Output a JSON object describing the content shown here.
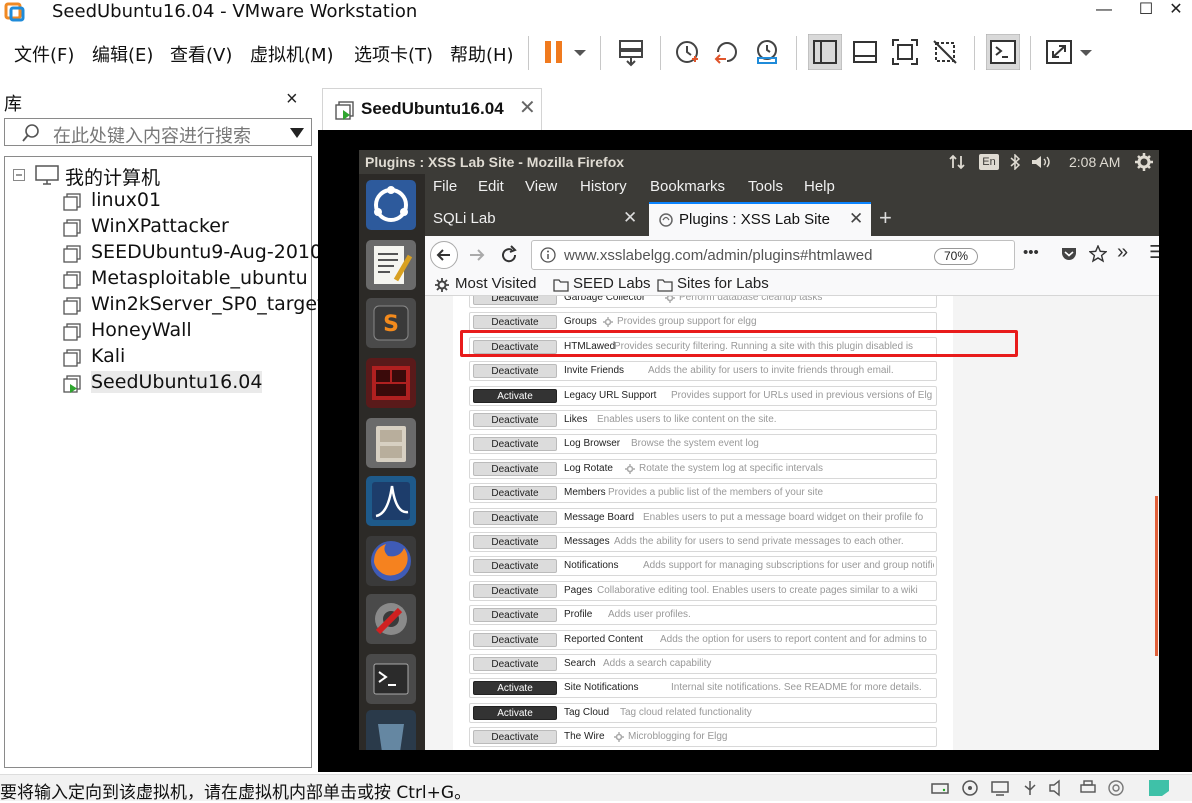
{
  "window": {
    "title": "SeedUbuntu16.04 - VMware Workstation",
    "minimize": "—",
    "maximize": "☐",
    "close": "✕"
  },
  "menu": [
    "文件(F)",
    "编辑(E)",
    "查看(V)",
    "虚拟机(M)",
    "选项卡(T)",
    "帮助(H)"
  ],
  "library": {
    "title": "库",
    "close": "×",
    "search_placeholder": "在此处键入内容进行搜索",
    "root": "我的计算机",
    "vms": [
      "linux01",
      "WinXPattacker",
      "SEEDUbuntu9-Aug-2010",
      "Metasploitable_ubuntu",
      "Win2kServer_SP0_target",
      "HoneyWall",
      "Kali",
      "SeedUbuntu16.04"
    ],
    "selected": "SeedUbuntu16.04"
  },
  "vm_tab": {
    "label": "SeedUbuntu16.04",
    "close": "✕"
  },
  "ubuntu": {
    "window_title": "Plugins : XSS Lab Site - Mozilla Firefox",
    "keyboard": "En",
    "clock": "2:08 AM"
  },
  "firefox": {
    "menus": [
      "File",
      "Edit",
      "View",
      "History",
      "Bookmarks",
      "Tools",
      "Help"
    ],
    "tabs": [
      {
        "label": "SQLi Lab",
        "close": "✕"
      },
      {
        "label": "Plugins : XSS Lab Site",
        "close": "✕"
      }
    ],
    "new_tab": "+",
    "url": "www.xsslabelgg.com/admin/plugins#htmlawed",
    "zoom": "70%",
    "page_actions": "•••",
    "overflow": "»",
    "menu_button": "☰",
    "bookmarks": [
      "Most Visited",
      "SEED Labs",
      "Sites for Labs"
    ]
  },
  "plugins": [
    {
      "action": "Deactivate",
      "name": "Garbage Collector",
      "gear": true,
      "desc": "Perform database cleanup tasks"
    },
    {
      "action": "Deactivate",
      "name": "Groups",
      "gear": true,
      "desc": "Provides group support for elgg"
    },
    {
      "action": "Deactivate",
      "name": "HTMLawed",
      "gear": false,
      "desc": "Provides security filtering. Running a site with this plugin disabled is"
    },
    {
      "action": "Deactivate",
      "name": "Invite Friends",
      "gear": false,
      "desc": "Adds the ability for users to invite friends through email."
    },
    {
      "action": "Activate",
      "name": "Legacy URL Support",
      "gear": false,
      "desc": "Provides support for URLs used in previous versions of Elg"
    },
    {
      "action": "Deactivate",
      "name": "Likes",
      "gear": false,
      "desc": "Enables users to like content on the site."
    },
    {
      "action": "Deactivate",
      "name": "Log Browser",
      "gear": false,
      "desc": "Browse the system event log"
    },
    {
      "action": "Deactivate",
      "name": "Log Rotate",
      "gear": true,
      "desc": "Rotate the system log at specific intervals"
    },
    {
      "action": "Deactivate",
      "name": "Members",
      "gear": false,
      "desc": "Provides a public list of the members of your site"
    },
    {
      "action": "Deactivate",
      "name": "Message Board",
      "gear": false,
      "desc": "Enables users to put a message board widget on their profile fo"
    },
    {
      "action": "Deactivate",
      "name": "Messages",
      "gear": false,
      "desc": "Adds the ability for users to send private messages to each other."
    },
    {
      "action": "Deactivate",
      "name": "Notifications",
      "gear": false,
      "desc": "Adds support for managing subscriptions for user and group notific"
    },
    {
      "action": "Deactivate",
      "name": "Pages",
      "gear": false,
      "desc": "Collaborative editing tool. Enables users to create pages similar to a wiki"
    },
    {
      "action": "Deactivate",
      "name": "Profile",
      "gear": false,
      "desc": "Adds user profiles."
    },
    {
      "action": "Deactivate",
      "name": "Reported Content",
      "gear": false,
      "desc": "Adds the option for users to report content and for admins to"
    },
    {
      "action": "Deactivate",
      "name": "Search",
      "gear": false,
      "desc": "Adds a search capability"
    },
    {
      "action": "Activate",
      "name": "Site Notifications",
      "gear": false,
      "desc": "Internal site notifications. See README for more details."
    },
    {
      "action": "Activate",
      "name": "Tag Cloud",
      "gear": false,
      "desc": "Tag cloud related functionality"
    },
    {
      "action": "Deactivate",
      "name": "The Wire",
      "gear": true,
      "desc": "Microblogging for Elgg"
    }
  ],
  "status": {
    "message": "要将输入定向到该虚拟机，请在虚拟机内部单击或按 Ctrl+G。"
  },
  "colors": {
    "highlight": "#e81b1b",
    "pause": "#f07a1e",
    "ubuntu_panel": "#3c3b37",
    "firefox_accent": "#0a84ff"
  }
}
